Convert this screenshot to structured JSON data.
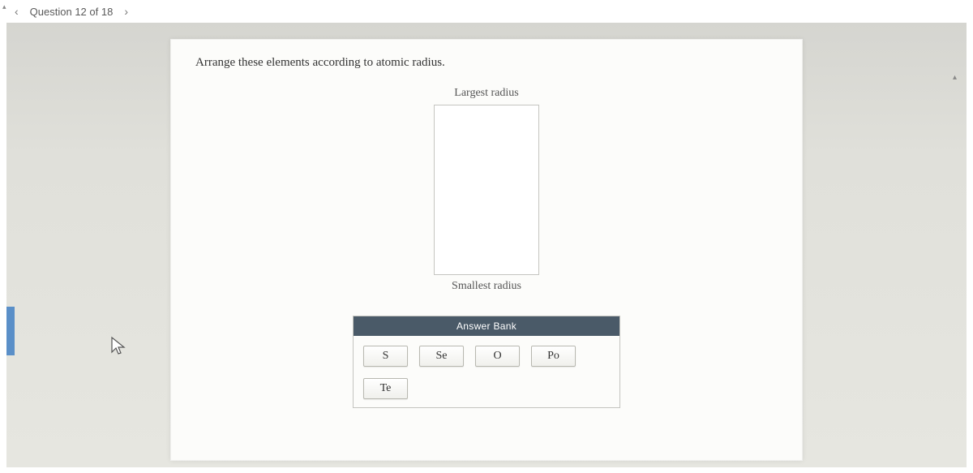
{
  "nav": {
    "prev": "‹",
    "label": "Question 12 of 18",
    "next": "›"
  },
  "prompt": "Arrange these elements according to atomic radius.",
  "ranking": {
    "top_label": "Largest radius",
    "bottom_label": "Smallest radius"
  },
  "answer_bank": {
    "header": "Answer Bank",
    "tiles": [
      "S",
      "Se",
      "O",
      "Po",
      "Te"
    ]
  }
}
